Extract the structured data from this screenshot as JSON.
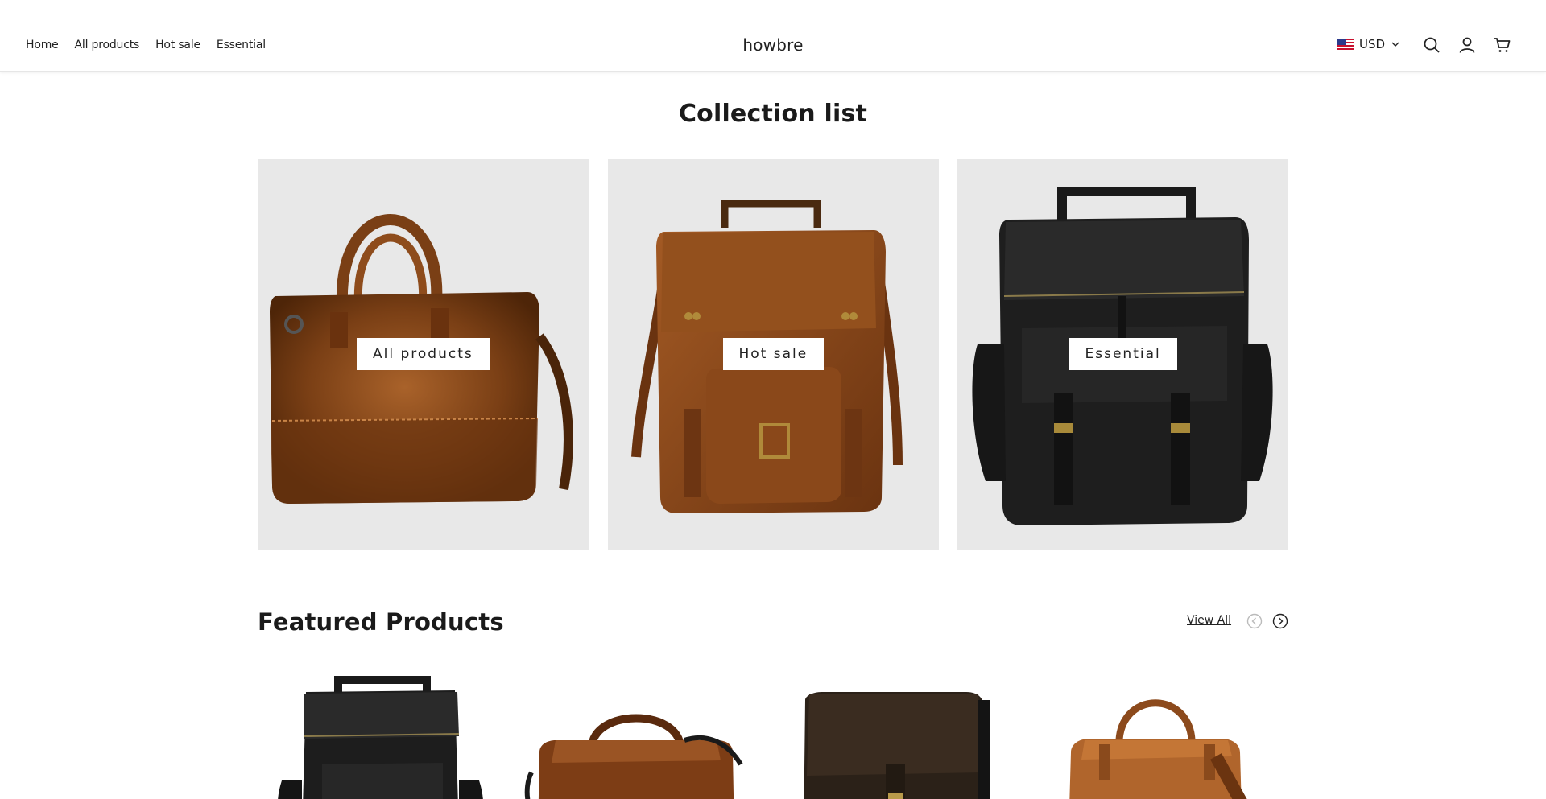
{
  "header": {
    "nav": [
      {
        "label": "Home"
      },
      {
        "label": "All products"
      },
      {
        "label": "Hot sale"
      },
      {
        "label": "Essential"
      }
    ],
    "brand": "howbre",
    "currency": "USD",
    "icons": [
      "us-flag-icon",
      "chevron-down-icon",
      "search-icon",
      "account-icon",
      "cart-icon"
    ]
  },
  "collection": {
    "title": "Collection list",
    "cards": [
      {
        "label": "All products",
        "image": "brown-briefcase"
      },
      {
        "label": "Hot sale",
        "image": "brown-backpack"
      },
      {
        "label": "Essential",
        "image": "black-backpack"
      }
    ]
  },
  "featured": {
    "title": "Featured Products",
    "view_all": "View All",
    "icons": [
      "arrow-left-circle-icon",
      "arrow-right-circle-icon"
    ],
    "products": [
      {
        "image": "black-backpack"
      },
      {
        "image": "brown-duffel-bag"
      },
      {
        "image": "dark-messenger-bag"
      },
      {
        "image": "tan-duffel-bag"
      }
    ]
  },
  "colors": {
    "card_bg": "#e8e8e8",
    "leather_brown": "#8a4a1e",
    "leather_black": "#1c1c1c",
    "text": "#1a1a1a"
  }
}
